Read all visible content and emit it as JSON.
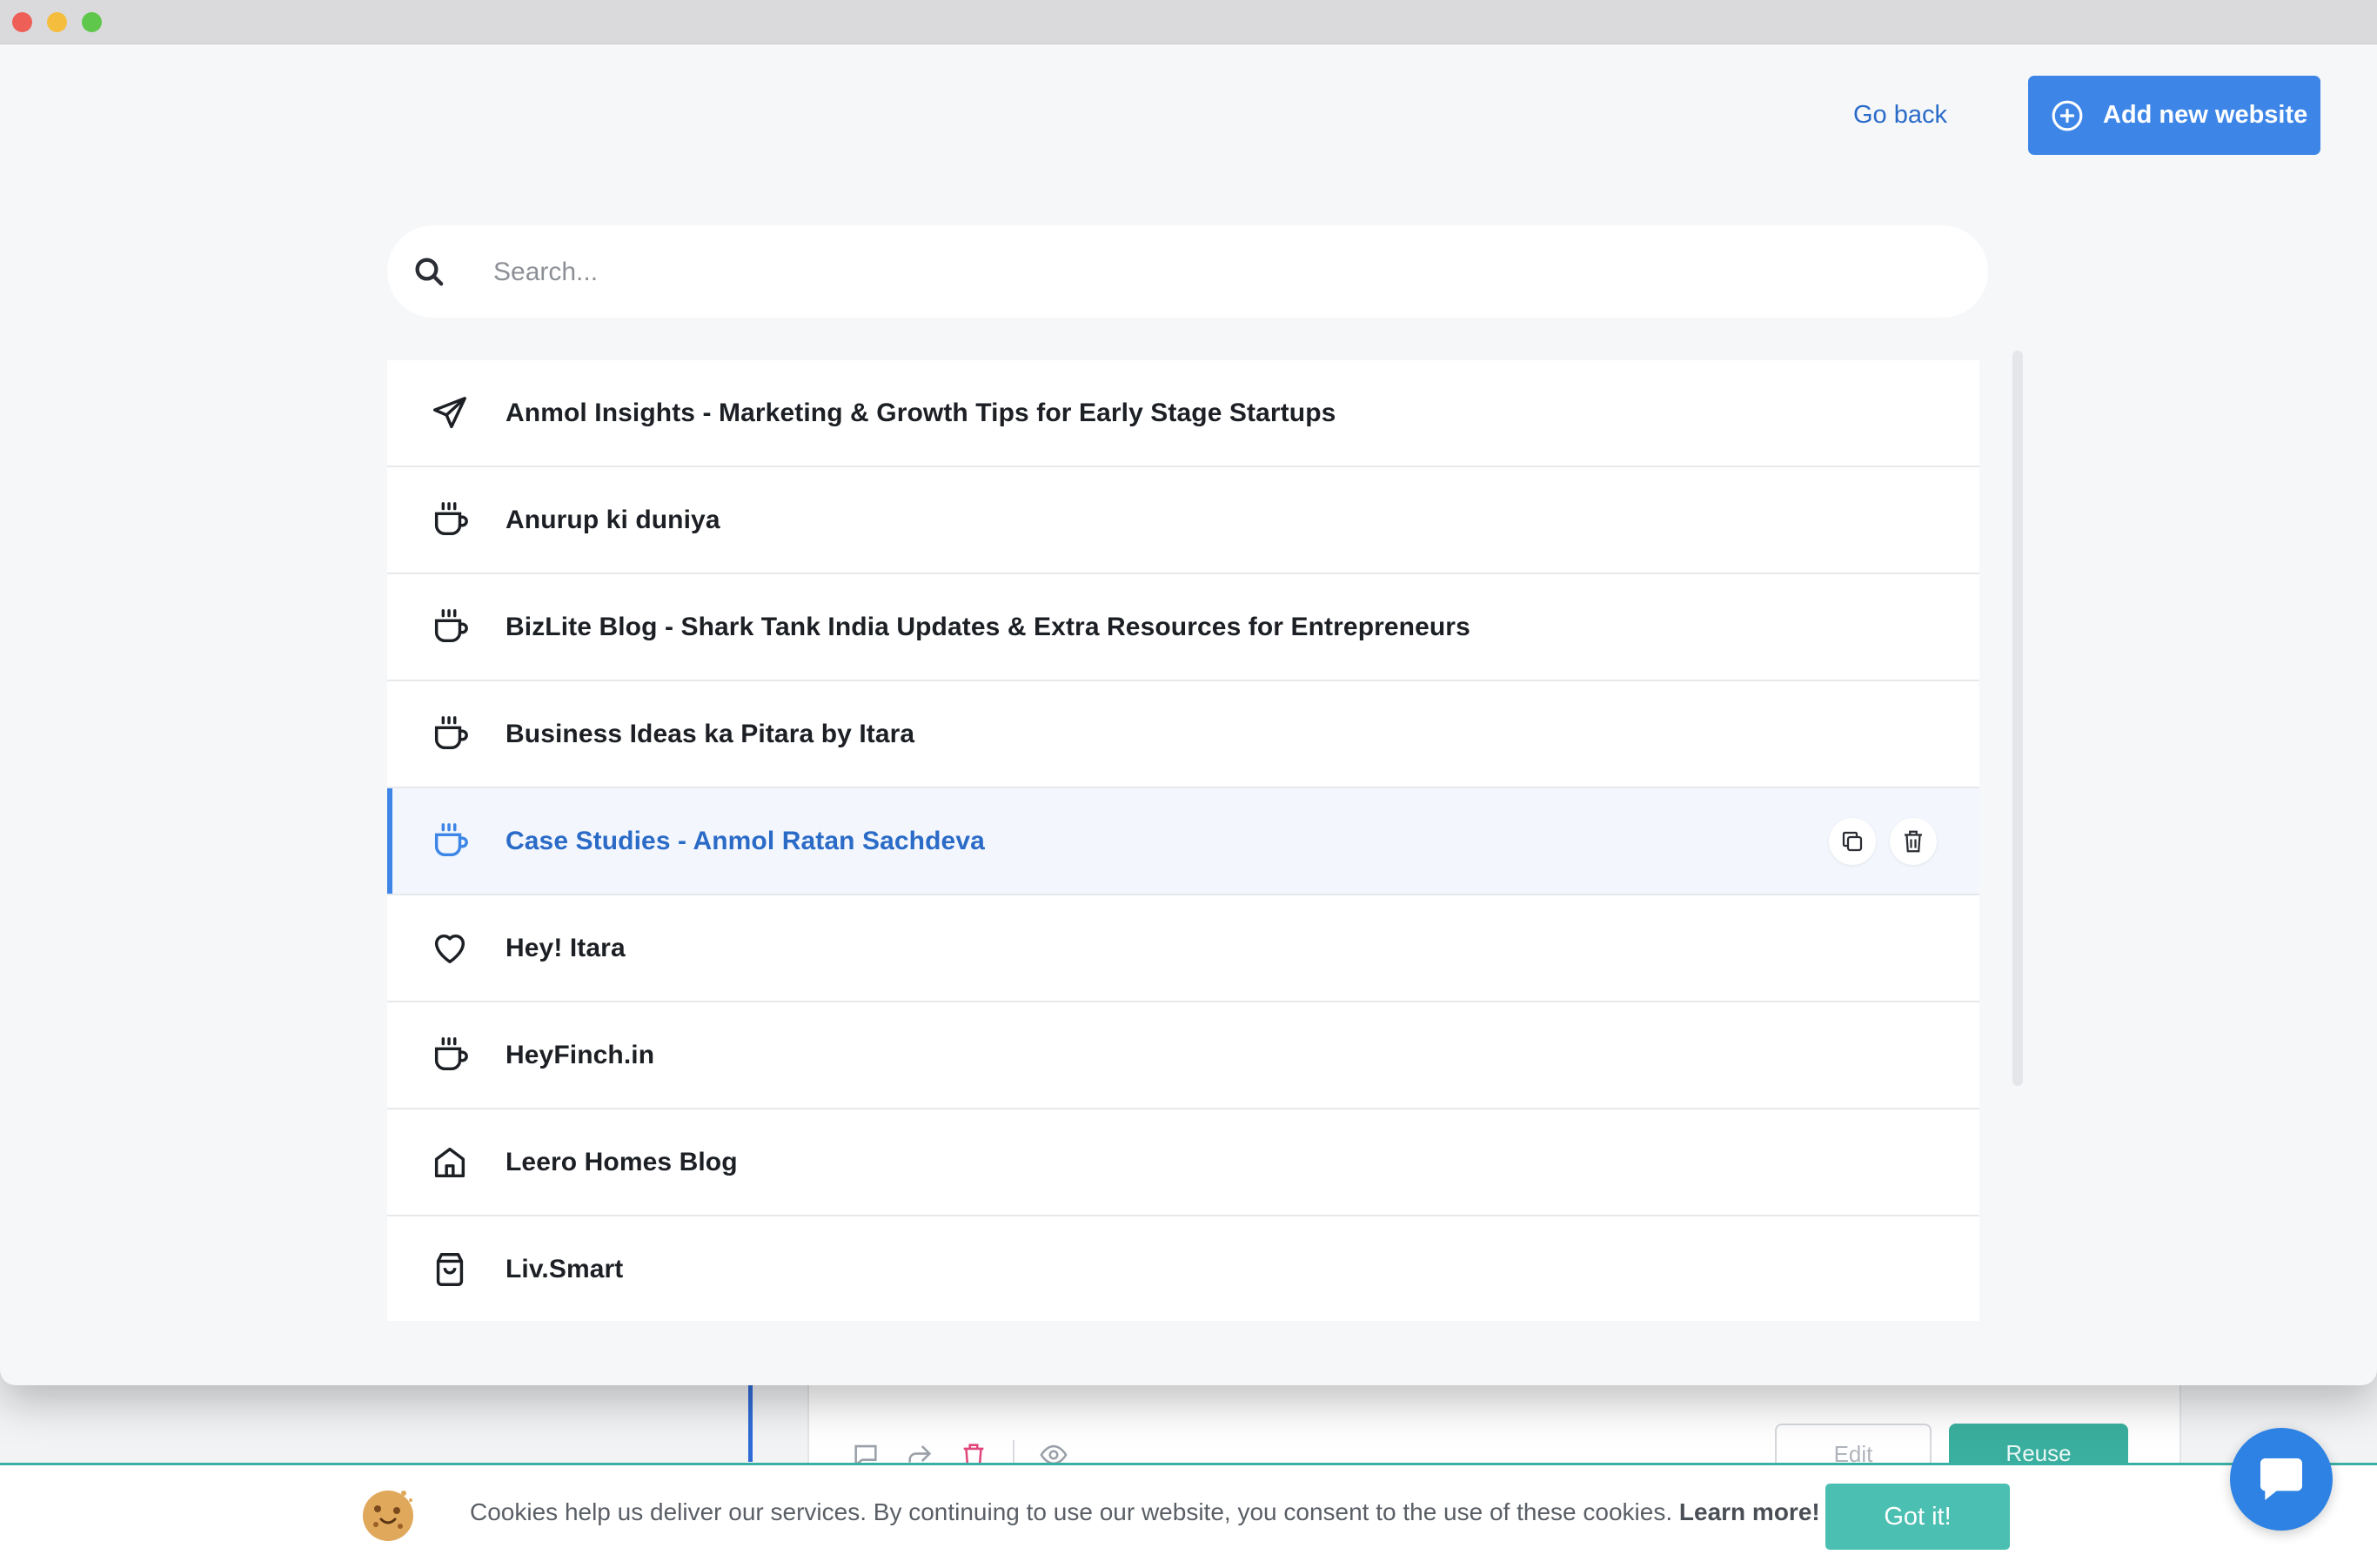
{
  "header": {
    "go_back_label": "Go back",
    "add_button_label": "Add new website"
  },
  "search": {
    "placeholder": "Search...",
    "value": ""
  },
  "websites": [
    {
      "label": "Anmol Insights - Marketing & Growth Tips for Early Stage Startups",
      "icon": "paper-plane-icon"
    },
    {
      "label": "Anurup ki duniya",
      "icon": "coffee-cup-icon"
    },
    {
      "label": "BizLite Blog - Shark Tank India Updates & Extra Resources for Entrepreneurs",
      "icon": "coffee-cup-icon"
    },
    {
      "label": "Business Ideas ka Pitara by Itara",
      "icon": "coffee-cup-icon"
    },
    {
      "label": "Case Studies - Anmol Ratan Sachdeva",
      "icon": "coffee-cup-icon",
      "active": true
    },
    {
      "label": "Hey! Itara",
      "icon": "heart-icon"
    },
    {
      "label": "HeyFinch.in",
      "icon": "coffee-cup-icon"
    },
    {
      "label": "Leero Homes Blog",
      "icon": "home-icon"
    },
    {
      "label": "Liv.Smart",
      "icon": "shopping-bag-icon"
    }
  ],
  "background": {
    "edit_label": "Edit",
    "reuse_label": "Reuse"
  },
  "cookie_banner": {
    "text": "Cookies help us deliver our services. By continuing to use our website, you consent to the use of these cookies.",
    "learn_more": "Learn more!",
    "button": "Got it!"
  },
  "colors": {
    "accent": "#3d86e8",
    "link": "#2b6bc8",
    "cookie_button": "#4bbfb1",
    "reuse_button": "#3aaf9f"
  }
}
